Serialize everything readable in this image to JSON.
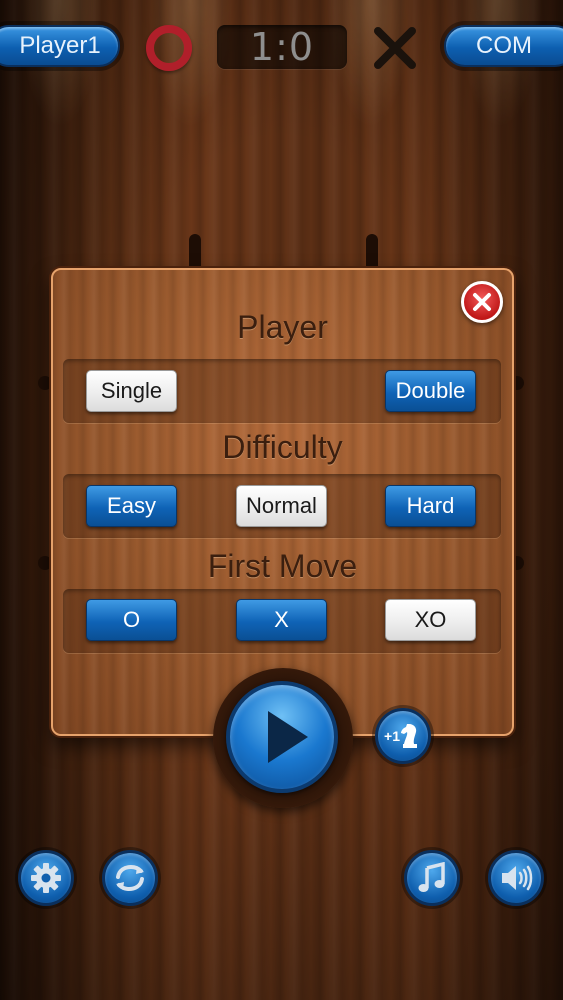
{
  "header": {
    "player_left": "Player1",
    "score": "1:0",
    "player_right": "COM"
  },
  "dialog": {
    "player_title": "Player",
    "player_options": [
      "Single",
      "Double"
    ],
    "player_selected": "Single",
    "difficulty_title": "Difficulty",
    "difficulty_options": [
      "Easy",
      "Normal",
      "Hard"
    ],
    "difficulty_selected": "Normal",
    "first_move_title": "First Move",
    "first_move_options": [
      "O",
      "X",
      "XO"
    ],
    "first_move_selected": "XO"
  },
  "extra_button_label": "+1",
  "icons": {
    "close": "close-icon",
    "play": "play-icon",
    "knight": "chess-knight-icon",
    "settings": "gear-icon",
    "restart": "refresh-icon",
    "music": "music-note-icon",
    "sound": "speaker-icon"
  },
  "colors": {
    "accent_blue": "#0f63b6",
    "o_mark": "#b01f2a",
    "x_mark": "#1a120c",
    "close_red": "#c01818"
  }
}
